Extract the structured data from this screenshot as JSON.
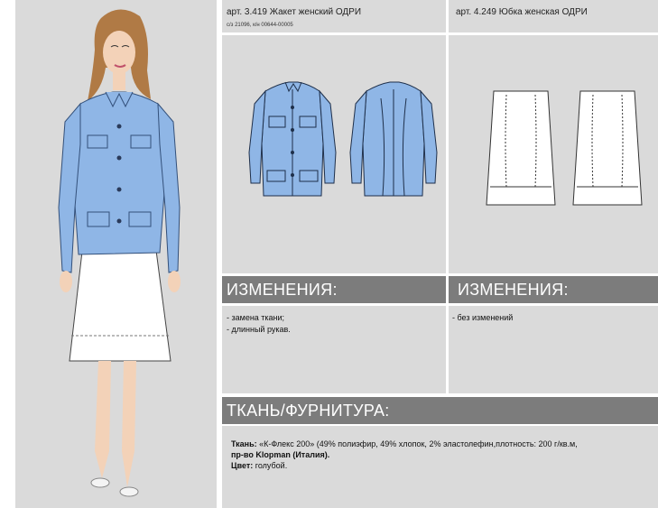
{
  "jacket": {
    "article_title": "арт.  3.419  Жакет женский ОДРИ",
    "article_sub": "с/з 21096, к/н 00644-00005"
  },
  "skirt": {
    "article_title": "арт.  4.249  Юбка женская ОДРИ"
  },
  "changes_left": {
    "heading": "ИЗМЕНЕНИЯ:",
    "items": [
      "- замена ткани;",
      "- длинный рукав."
    ]
  },
  "changes_right": {
    "heading": "ИЗМЕНЕНИЯ:",
    "items": [
      "- без изменений"
    ]
  },
  "fabric": {
    "heading": "ТКАНЬ/ФУРНИТУРА:",
    "fabric_label": "Ткань:",
    "fabric_value": " «К-Флекс 200» (49% полиэфир, 49% хлопок, 2% эластолефин,плотность: 200 г/кв.м,",
    "fabric_value_2": "пр-во Klopman (Италия).",
    "color_label": "Цвет:",
    "color_value": " голубой."
  },
  "colors": {
    "jacket_blue": "#8fb6e6",
    "panel_gray": "#dadada",
    "heading_gray": "#7c7c7c"
  }
}
